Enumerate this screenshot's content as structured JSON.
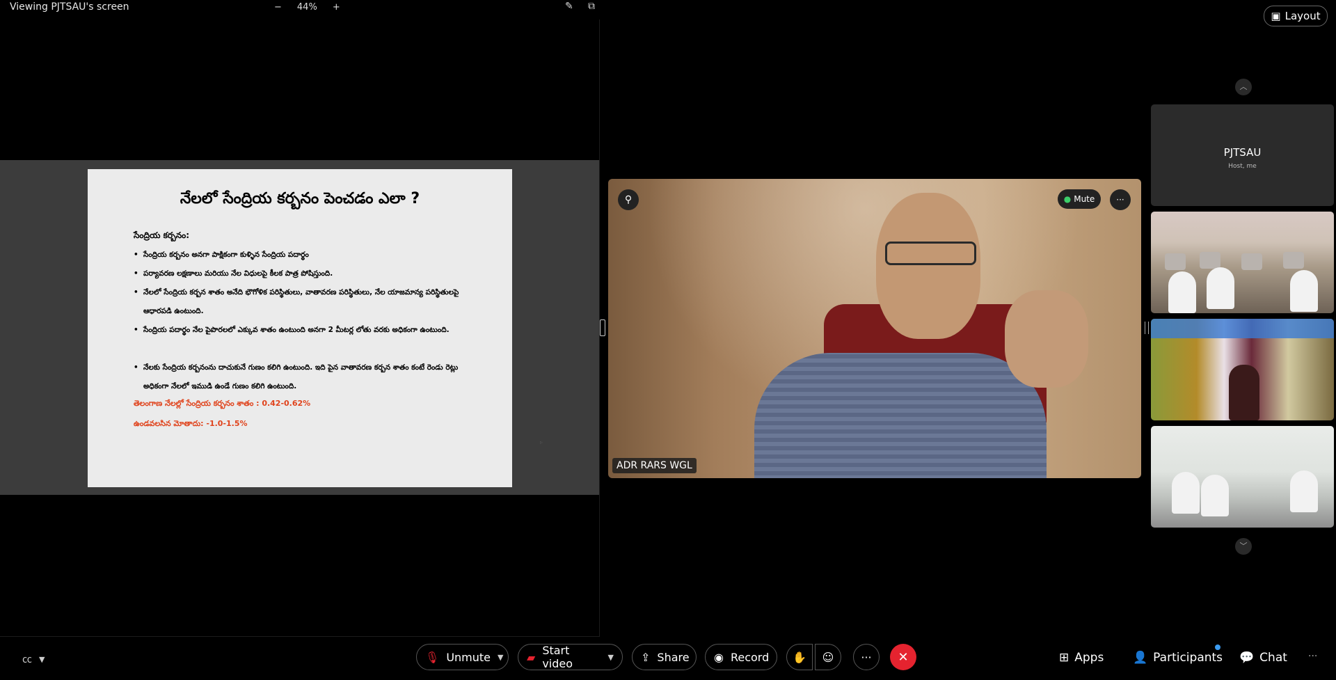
{
  "topbar": {
    "share_title": "Viewing PJTSAU's screen",
    "zoom_minus": "−",
    "zoom_level": "44%",
    "zoom_plus": "+"
  },
  "slide": {
    "title": "నేలలో సేంద్రియ కర్బనం పెంచడం ఎలా ?",
    "heading": "సేంద్రియ కర్బనం:",
    "bullets": [
      "సేంద్రియ కర్బనం అనగా పాక్షికంగా కుళ్ళిన సేంద్రియ పదార్థం",
      "పర్యావరణ లక్షణాలు మరియు నేల విధులపై కీలక పాత్ర పోషిస్తుంది.",
      "నేలలో సేంద్రియ కర్బన శాతం అనేది భౌగోళిక పరిస్థితులు, వాతావరణ పరిస్థితులు, నేల యాజమాన్య పరిస్థితులపై ఆధారపడి ఉంటుంది.",
      "సేంద్రియ పదార్థం నేల పైపొరలలో ఎక్కువ శాతం ఉంటుంది అనగా 2 మీటర్ల లోతు వరకు అధికంగా ఉంటుంది.",
      "నేలకు సేంద్రియ కర్బనంను దాచుకునే గుణం కలిగి ఉంటుంది. ఇది పైన వాతావరణ కర్బన శాతం కంటే రెండు రెట్లు అధికంగా నేలలో ఇముడి ఉండే గుణం కలిగి ఉంటుంది."
    ],
    "red_line_1": "తెలంగాణ నేలల్లో సేంద్రియ కర్బనం శాతం : 0.42-0.62%",
    "red_line_2": "ఉండవలసిన మోతాదు: -1.0-1.5%"
  },
  "main_video": {
    "name": "ADR RARS WGL",
    "mute_label": "Mute"
  },
  "layout_button": "Layout",
  "thumbnails": {
    "self_name": "PJTSAU",
    "self_role": "Host, me"
  },
  "bottombar": {
    "unmute": "Unmute",
    "start_video": "Start video",
    "share": "Share",
    "record": "Record",
    "apps": "Apps",
    "participants": "Participants",
    "chat": "Chat"
  },
  "colors": {
    "end_call": "#e5232f",
    "slide_highlight": "#e0431c",
    "notification": "#3b9bf0"
  }
}
